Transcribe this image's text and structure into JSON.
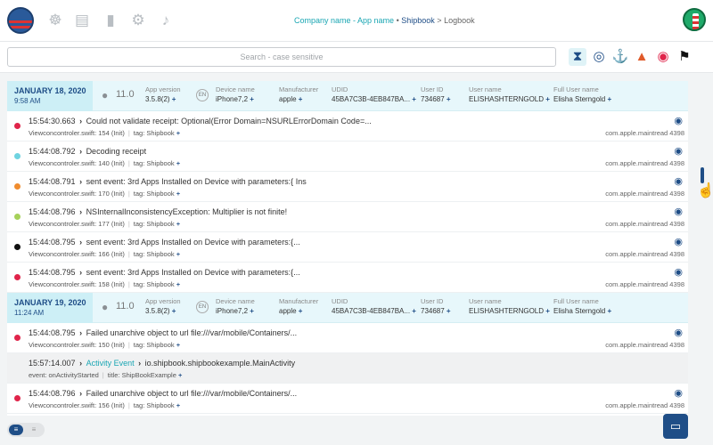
{
  "breadcrumb": {
    "company": "Company name - App name",
    "bullet": "•",
    "app": "Shipbook",
    "sep": ">",
    "page": "Logbook"
  },
  "search": {
    "placeholder": "Search - case sensitive"
  },
  "nav_icons": [
    "steering-wheel-icon",
    "book-icon",
    "bar-chart-icon",
    "gears-icon",
    "bell-icon"
  ],
  "filter_icons": [
    "hourglass-icon",
    "compass-icon",
    "anchor-icon",
    "lighthouse-icon",
    "lifebuoy-icon",
    "pirate-flag-icon"
  ],
  "session_labels": {
    "app_version": "App version",
    "device_name": "Device name",
    "manufacturer": "Manufacturer",
    "udid": "UDID",
    "user_id": "User ID",
    "user_name": "User name",
    "full_user_name": "Full User name"
  },
  "sessions": [
    {
      "date": "JANUARY 18, 2020",
      "time": "9:58 AM",
      "os_version": "11.0",
      "app_version": "3.5.8(2)",
      "lang": "EN",
      "device_name": "iPhone7,2",
      "manufacturer": "apple",
      "udid": "45BA7C3B-4EB847BA...",
      "user_id": "734687",
      "user_name": "ELISHASHTERNGOLD",
      "full_user_name": "Elisha Sterngold",
      "logs": [
        {
          "time": "15:54:30.663",
          "message": "Could not validate receipt: Optional(Error Domain=NSURLErrorDomain Code=...",
          "file": "Viewconcontroler.swift: 154 (Init)",
          "tag": "tag: Shipbook",
          "thread": "com.apple.maintread 4398",
          "color": "#e0244a"
        },
        {
          "time": "15:44:08.792",
          "message": "Decoding receipt",
          "file": "Viewconcontroler.swift: 140 (Init)",
          "tag": "tag: Shipbook",
          "thread": "com.apple.maintread 4398",
          "color": "#6fd3e0"
        },
        {
          "time": "15:44:08.791",
          "message": "sent event: 3rd Apps Installed on Device with parameters:{ Ins",
          "file": "Viewconcontroler.swift: 170 (Init)",
          "tag": "tag: Shipbook",
          "thread": "com.apple.maintread 4398",
          "color": "#f08c2e"
        },
        {
          "time": "15:44:08.796",
          "message": "NSInternalInconsistencyException: Multiplier is not finite!",
          "file": "Viewconcontroler.swift: 177 (Init)",
          "tag": "tag: Shipbook",
          "thread": "com.apple.maintread 4398",
          "color": "#a6d15a"
        },
        {
          "time": "15:44:08.795",
          "message": "sent event: 3rd Apps Installed on Device with parameters:{...",
          "file": "Viewconcontroler.swift: 166 (Init)",
          "tag": "tag: Shipbook",
          "thread": "com.apple.maintread 4398",
          "color": "#111111"
        },
        {
          "time": "15:44:08.795",
          "message": "sent event: 3rd Apps Installed on Device with parameters:{...",
          "file": "Viewconcontroler.swift: 158 (Init)",
          "tag": "tag: Shipbook",
          "thread": "com.apple.maintread 4398",
          "color": "#e0244a"
        }
      ]
    },
    {
      "date": "JANUARY 19, 2020",
      "time": "11:24 AM",
      "os_version": "11.0",
      "app_version": "3.5.8(2)",
      "lang": "EN",
      "device_name": "iPhone7,2",
      "manufacturer": "apple",
      "udid": "45BA7C3B-4EB847BA...",
      "user_id": "734687",
      "user_name": "ELISHASHTERNGOLD",
      "full_user_name": "Elisha Sterngold",
      "logs": [
        {
          "time": "15:44:08.795",
          "message": "Failed unarchive object to url file:///var/mobile/Containers/...",
          "file": "Viewconcontroler.swift: 150 (Init)",
          "tag": "tag: Shipbook",
          "thread": "com.apple.maintread 4398",
          "color": "#e0244a"
        },
        {
          "time": "15:57:14.007",
          "event_label": "Activity Event",
          "message": "io.shipbook.shipbookexample.MainActivity",
          "file": "event: onActivityStarted",
          "tag": "title: ShipBookExample",
          "activity": true
        },
        {
          "time": "15:44:08.796",
          "message": "Failed unarchive object to url file:///var/mobile/Containers/...",
          "file": "Viewconcontroler.swift: 156 (Init)",
          "tag": "tag: Shipbook",
          "thread": "com.apple.maintread 4398",
          "color": "#e0244a"
        }
      ]
    }
  ]
}
